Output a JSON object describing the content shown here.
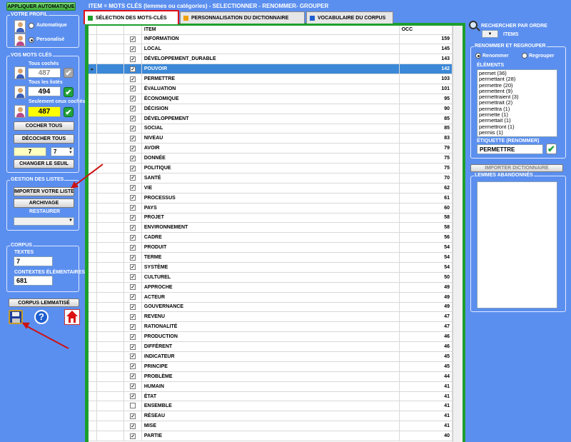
{
  "header": {
    "title": "ITEM  = MOTS CLÉS (lemmes ou catégories) - SELECTIONNER - RENOMMER- GROUPER"
  },
  "left": {
    "apply_button": "APPLIQUER AUTOMATIQUE",
    "profil": {
      "title": "VOTRE PROFIL",
      "options": [
        "Automatique",
        "Personalisé"
      ],
      "selected": "Personalisé"
    },
    "keywords": {
      "title": "VOS MOTS CLÉS",
      "all_checked_label": "Tous cochés",
      "all_checked_value": "487",
      "all_listed_label": "Tous les listés",
      "all_listed_value": "494",
      "only_checked_label": "Seulement ceux cochés",
      "only_checked_value": "487",
      "check_all": "COCHER TOUS",
      "uncheck_all": "DÉCOCHER TOUS",
      "threshold_value": "7",
      "threshold_spin": "7",
      "change_threshold": "CHANGER LE SEUIL"
    },
    "lists": {
      "title": "GESTION DES LISTES",
      "import": "IMPORTER VOTRE LISTE",
      "archive": "ARCHIVAGE",
      "restore_label": "RESTAURER",
      "restore_value": ""
    },
    "corpus": {
      "title": "CORPUS",
      "texts_label": "TEXTES",
      "texts_value": "7",
      "contexts_label": "CONTEXTES ÉLÉMENTAIRES",
      "contexts_value": "681"
    },
    "lemmatized": "CORPUS LEMMATISÉ",
    "icons": [
      "save-icon",
      "help-icon",
      "home-icon"
    ]
  },
  "tabs": [
    {
      "label": "SÉLECTION DES MOTS-CLÉS",
      "color": "#1e9e2c",
      "active": true
    },
    {
      "label": "PERSONNALISATION DU DICTIONNAIRE",
      "color": "#f0a000",
      "active": false
    },
    {
      "label": "VOCABULAIRE DU CORPUS",
      "color": "#1f5fd0",
      "active": false
    }
  ],
  "table": {
    "columns": [
      "ITEM",
      "OCC"
    ],
    "selected_index": 3,
    "rows": [
      {
        "item": "INFORMATION",
        "occ": "159",
        "checked": true
      },
      {
        "item": "LOCAL",
        "occ": "145",
        "checked": true
      },
      {
        "item": "DÉVELOPPEMENT_DURABLE",
        "occ": "143",
        "checked": true
      },
      {
        "item": "POUVOIR",
        "occ": "142",
        "checked": true
      },
      {
        "item": "PERMETTRE",
        "occ": "103",
        "checked": true
      },
      {
        "item": "ÉVALUATION",
        "occ": "101",
        "checked": true
      },
      {
        "item": "ÉCONOMIQUE",
        "occ": "95",
        "checked": true
      },
      {
        "item": "DÉCISION",
        "occ": "90",
        "checked": true
      },
      {
        "item": "DÉVELOPPEMENT",
        "occ": "85",
        "checked": true
      },
      {
        "item": "SOCIAL",
        "occ": "85",
        "checked": true
      },
      {
        "item": "NIVEAU",
        "occ": "83",
        "checked": true
      },
      {
        "item": "AVOIR",
        "occ": "79",
        "checked": true
      },
      {
        "item": "DONNÉE",
        "occ": "75",
        "checked": true
      },
      {
        "item": "POLITIQUE",
        "occ": "75",
        "checked": true
      },
      {
        "item": "SANTÉ",
        "occ": "70",
        "checked": true
      },
      {
        "item": "VIE",
        "occ": "62",
        "checked": true
      },
      {
        "item": "PROCESSUS",
        "occ": "61",
        "checked": true
      },
      {
        "item": "PAYS",
        "occ": "60",
        "checked": true
      },
      {
        "item": "PROJET",
        "occ": "58",
        "checked": true
      },
      {
        "item": "ENVIRONNEMENT",
        "occ": "58",
        "checked": true
      },
      {
        "item": "CADRE",
        "occ": "56",
        "checked": true
      },
      {
        "item": "PRODUIT",
        "occ": "54",
        "checked": true
      },
      {
        "item": "TERME",
        "occ": "54",
        "checked": true
      },
      {
        "item": "SYSTÈME",
        "occ": "54",
        "checked": true
      },
      {
        "item": "CULTUREL",
        "occ": "50",
        "checked": true
      },
      {
        "item": "APPROCHE",
        "occ": "49",
        "checked": true
      },
      {
        "item": "ACTEUR",
        "occ": "49",
        "checked": true
      },
      {
        "item": "GOUVERNANCE",
        "occ": "49",
        "checked": true
      },
      {
        "item": "REVENU",
        "occ": "47",
        "checked": true
      },
      {
        "item": "RATIONALITÉ",
        "occ": "47",
        "checked": true
      },
      {
        "item": "PRODUCTION",
        "occ": "46",
        "checked": true
      },
      {
        "item": "DIFFÉRENT",
        "occ": "46",
        "checked": true
      },
      {
        "item": "INDICATEUR",
        "occ": "45",
        "checked": true
      },
      {
        "item": "PRINCIPE",
        "occ": "45",
        "checked": true
      },
      {
        "item": "PROBLÈME",
        "occ": "44",
        "checked": true
      },
      {
        "item": "HUMAIN",
        "occ": "41",
        "checked": true
      },
      {
        "item": "ÉTAT",
        "occ": "41",
        "checked": true
      },
      {
        "item": "ENSEMBLE",
        "occ": "41",
        "checked": false
      },
      {
        "item": "RÉSEAU",
        "occ": "41",
        "checked": true
      },
      {
        "item": "MISE",
        "occ": "41",
        "checked": true
      },
      {
        "item": "PARTIE",
        "occ": "40",
        "checked": true
      }
    ]
  },
  "right": {
    "search_label": "RECHERCHER PAR ORDRE",
    "search_value": "ITEMS",
    "rename": {
      "title": "RENOMMER ET REGROUPER",
      "options": [
        "Renommer",
        "Regrouper"
      ],
      "selected": "Renommer",
      "elements_label": "ÉLÉMENTS",
      "elements": [
        "permet (36)",
        "permettant (28)",
        "permettre (20)",
        "permettent (9)",
        "permettraient (3)",
        "permettrait (2)",
        "permettra (1)",
        "permette (1)",
        "permettait (1)",
        "permettront (1)",
        "permis (1)"
      ],
      "label_title": "ÉTIQUETTE (RENOMMER)",
      "label_value": "PERMETTRE"
    },
    "import_dict": "IMPORTER DICTIONNAIRE",
    "abandoned_title": "LEMMES ABANDONNÉS"
  }
}
